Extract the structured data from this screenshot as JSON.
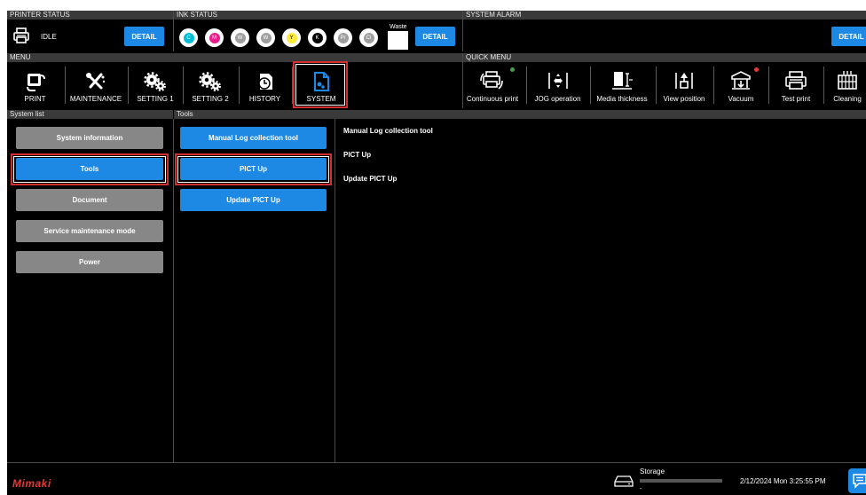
{
  "sections": {
    "printer_status": "PRINTER STATUS",
    "ink_status": "INK STATUS",
    "system_alarm": "SYSTEM ALARM",
    "menu": "MENU",
    "quick_menu": "QUICK MENU",
    "system_list": "System list",
    "tools": "Tools"
  },
  "printer": {
    "state": "IDLE",
    "detail_label": "DETAIL"
  },
  "inks": [
    {
      "code": "C",
      "color": "#00bcd4"
    },
    {
      "code": "M",
      "color": "#e91e8c"
    },
    {
      "code": "W",
      "color": "#9e9e9e"
    },
    {
      "code": "W",
      "color": "#9e9e9e"
    },
    {
      "code": "Y",
      "color": "#ffeb3b"
    },
    {
      "code": "K",
      "color": "#000000"
    },
    {
      "code": "Pr",
      "color": "#9e9e9e"
    },
    {
      "code": "Cl",
      "color": "#9e9e9e"
    }
  ],
  "ink_status": {
    "waste_label": "Waste",
    "detail_label": "DETAIL"
  },
  "alarm": {
    "detail_label": "DETAIL"
  },
  "menu": {
    "items": [
      {
        "label": "PRINT",
        "icon": "print-icon"
      },
      {
        "label": "MAINTENANCE",
        "icon": "maintenance-icon"
      },
      {
        "label": "SETTING 1",
        "icon": "gears-icon"
      },
      {
        "label": "SETTING 2",
        "icon": "gears-icon"
      },
      {
        "label": "HISTORY",
        "icon": "history-icon"
      },
      {
        "label": "SYSTEM",
        "icon": "system-file-icon"
      }
    ],
    "selected": "SYSTEM"
  },
  "quick_menu": {
    "items": [
      {
        "label": "Continuous print",
        "icon": "continuous-print-icon",
        "indicator": "#43a047"
      },
      {
        "label": "JOG operation",
        "icon": "jog-icon"
      },
      {
        "label": "Media thickness",
        "icon": "media-thickness-icon"
      },
      {
        "label": "View position",
        "icon": "view-position-icon"
      },
      {
        "label": "Vacuum",
        "icon": "vacuum-icon",
        "indicator": "#e53935"
      },
      {
        "label": "Test print",
        "icon": "test-print-icon"
      },
      {
        "label": "Cleaning",
        "icon": "cleaning-icon"
      }
    ]
  },
  "system_list": {
    "items": [
      {
        "label": "System information"
      },
      {
        "label": "Tools"
      },
      {
        "label": "Document"
      },
      {
        "label": "Service maintenance mode"
      },
      {
        "label": "Power"
      }
    ],
    "selected": "Tools"
  },
  "tools_list": {
    "items": [
      {
        "label": "Manual Log collection tool"
      },
      {
        "label": "PICT Up"
      },
      {
        "label": "Update PICT Up"
      }
    ],
    "selected": "PICT Up"
  },
  "info_panel": {
    "lines": [
      "Manual Log collection tool",
      "PICT Up",
      "Update PICT Up"
    ]
  },
  "footer": {
    "brand": "Mimaki",
    "storage_label": "Storage",
    "storage_sub": "-",
    "datetime": "2/12/2024 Mon 3:25:55 PM",
    "brand_color": "#e53935",
    "accent": "#1e88e5"
  }
}
